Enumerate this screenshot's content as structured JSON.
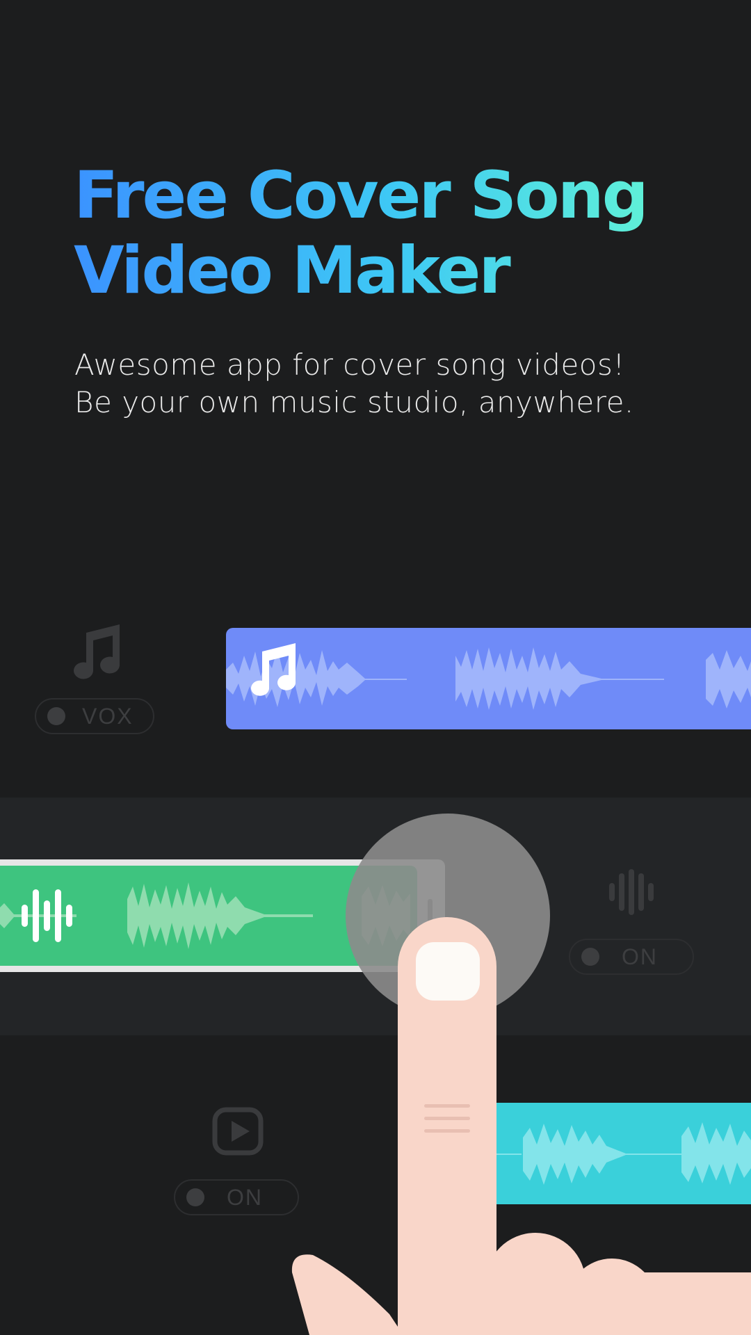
{
  "headline": {
    "line1": "Free Cover Song",
    "line2": "Video Maker"
  },
  "subtitle": {
    "line1": "Awesome app for cover song videos!",
    "line2": "Be your own music studio, anywhere."
  },
  "tracks": {
    "vox": {
      "icon": "music-note-icon",
      "toggle_label": "VOX",
      "color": "#6f8bf8"
    },
    "audio": {
      "icon": "waveform-bars-icon",
      "toggle_label": "ON",
      "color": "#3ec47f"
    },
    "video": {
      "icon": "play-video-icon",
      "toggle_label": "ON",
      "color": "#3ad0da"
    }
  },
  "colors": {
    "background": "#1c1d1e",
    "band": "#232527",
    "headline_gradient": [
      "#3b93ff",
      "#3ec8f5",
      "#5ff0d8"
    ],
    "finger": "#f9d6c9"
  }
}
